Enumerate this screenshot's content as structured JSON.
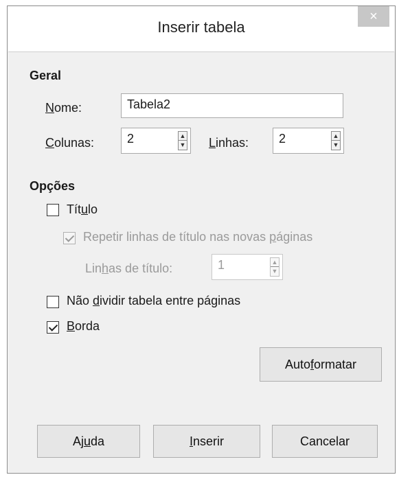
{
  "dialog": {
    "title": "Inserir tabela",
    "close_glyph": "×"
  },
  "geral": {
    "heading": "Geral",
    "nome_label_u": "N",
    "nome_label_rest": "ome:",
    "nome_value": "Tabela2",
    "colunas_label_u": "C",
    "colunas_label_rest": "olunas:",
    "colunas_value": "2",
    "linhas_label_u": "L",
    "linhas_label_rest": "inhas:",
    "linhas_value": "2"
  },
  "opcoes": {
    "heading": "Opções",
    "titulo_pre": "Tít",
    "titulo_u": "u",
    "titulo_post": "lo",
    "titulo_checked": false,
    "repetir_pre": "Repetir linhas de título nas novas ",
    "repetir_u": "p",
    "repetir_post": "áginas",
    "repetir_checked": true,
    "linhas_titulo_pre": "Lin",
    "linhas_titulo_u": "h",
    "linhas_titulo_post": "as de título:",
    "linhas_titulo_value": "1",
    "nao_dividir_pre": "Não ",
    "nao_dividir_u": "d",
    "nao_dividir_post": "ividir tabela entre páginas",
    "nao_dividir_checked": false,
    "borda_u": "B",
    "borda_post": "orda",
    "borda_checked": true,
    "autoformatar_pre": "Auto",
    "autoformatar_u": "f",
    "autoformatar_post": "ormatar"
  },
  "buttons": {
    "ajuda_pre": "Aj",
    "ajuda_u": "u",
    "ajuda_post": "da",
    "inserir_u": "I",
    "inserir_post": "nserir",
    "cancelar": "Cancelar"
  }
}
